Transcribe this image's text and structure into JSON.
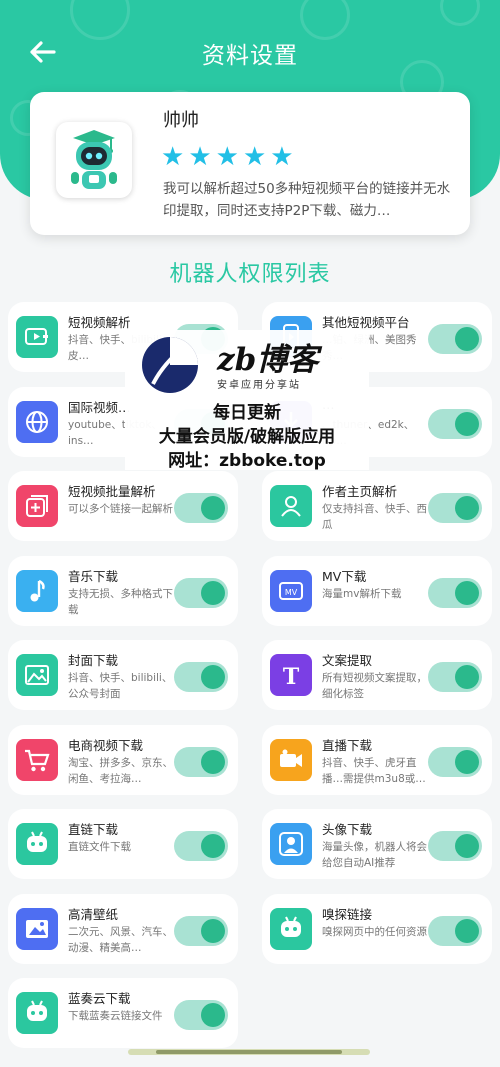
{
  "header": {
    "title": "资料设置",
    "back_icon": "arrow-left-icon",
    "background_color": "#2ac8a3"
  },
  "bot": {
    "name": "帅帅",
    "rating": 5,
    "star_color": "#22bfe6",
    "description": "我可以解析超过50多种短视频平台的链接并无水印提取，同时还支持P2P下载、磁力…"
  },
  "section_title": "机器人权限列表",
  "permissions": [
    {
      "name": "短视频解析",
      "desc": "抖音、快手、bilibili、皮…",
      "icon": "video-play-icon",
      "color": "#2bc79f",
      "enabled": true
    },
    {
      "name": "其他短视频平台",
      "desc": "…铂、绿洲、美图秀秀…",
      "icon": "phone-video-icon",
      "color": "#3aa0f0",
      "enabled": true
    },
    {
      "name": "国际视频…",
      "desc": "youtube、tiktok、ins…",
      "icon": "globe-icon",
      "color": "#4e6ef2",
      "enabled": true
    },
    {
      "name": "…",
      "desc": "、thuner、ed2k、ftp…",
      "icon": "download-icon",
      "color": "#6a5be8",
      "enabled": true
    },
    {
      "name": "短视频批量解析",
      "desc": "可以多个链接一起解析",
      "icon": "batch-add-icon",
      "color": "#f0456a",
      "enabled": true
    },
    {
      "name": "作者主页解析",
      "desc": "仅支持抖音、快手、西瓜",
      "icon": "user-icon",
      "color": "#2bc79f",
      "enabled": true
    },
    {
      "name": "音乐下载",
      "desc": "支持无损、多种格式下载",
      "icon": "music-note-icon",
      "color": "#3ab0f0",
      "enabled": true
    },
    {
      "name": "MV下载",
      "desc": "海量mv解析下载",
      "icon": "mv-icon",
      "color": "#4e6ef2",
      "enabled": true
    },
    {
      "name": "封面下载",
      "desc": "抖音、快手、bilibili、公众号封面",
      "icon": "image-icon",
      "color": "#2bc79f",
      "enabled": true
    },
    {
      "name": "文案提取",
      "desc": "所有短视频文案提取，细化标签",
      "icon": "text-t-icon",
      "color": "#7b3fe4",
      "enabled": true
    },
    {
      "name": "电商视频下载",
      "desc": "淘宝、拼多多、京东、闲鱼、考拉海…",
      "icon": "cart-icon",
      "color": "#f0456a",
      "enabled": true
    },
    {
      "name": "直播下载",
      "desc": "抖音、快手、虎牙直播…需提供m3u8或…",
      "icon": "live-camera-icon",
      "color": "#f7a41d",
      "enabled": true
    },
    {
      "name": "直链下载",
      "desc": "直链文件下载",
      "icon": "robot-icon",
      "color": "#2bc79f",
      "enabled": true
    },
    {
      "name": "头像下载",
      "desc": "海量头像，机器人将会给您自动AI推荐",
      "icon": "avatar-icon",
      "color": "#3aa0f0",
      "enabled": true
    },
    {
      "name": "高清壁纸",
      "desc": "二次元、风景、汽车、动漫、精美高…",
      "icon": "wallpaper-icon",
      "color": "#4e6ef2",
      "enabled": true
    },
    {
      "name": "嗅探链接",
      "desc": "嗅探网页中的任何资源",
      "icon": "robot-icon",
      "color": "#2bc79f",
      "enabled": true
    },
    {
      "name": "蓝奏云下载",
      "desc": "下载蓝奏云链接文件",
      "icon": "robot-icon",
      "color": "#2bc79f",
      "enabled": true
    }
  ],
  "watermark": {
    "brand": "zb博客",
    "subtitle": "安卓应用分享站",
    "line1": "每日更新",
    "line2": "大量会员版/破解版应用",
    "line3": "网址：zbboke.top"
  }
}
